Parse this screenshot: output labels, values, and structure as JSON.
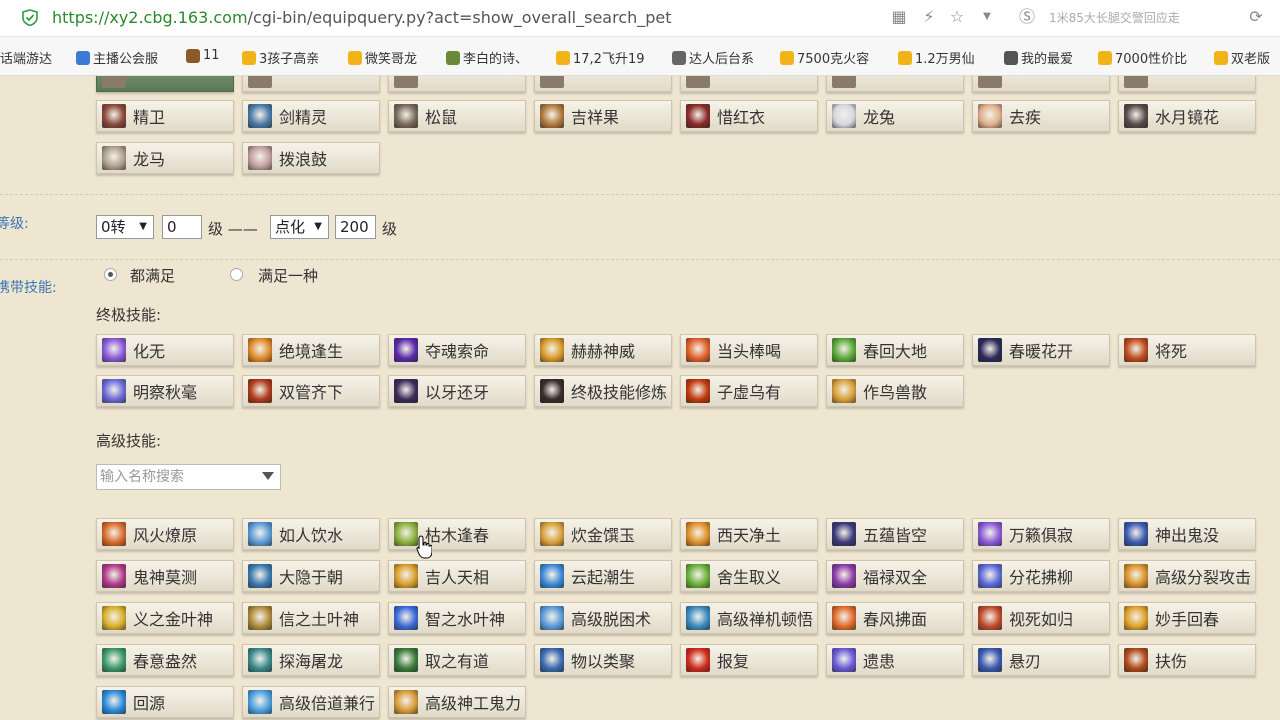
{
  "browser": {
    "url_host": "https://xy2.cbg.163.com",
    "url_path": "/cgi-bin/equipquery.py?act=show_overall_search_pet",
    "side_search": "1米85大长腿交警回应走",
    "bookmarks": [
      {
        "label": "话端游达",
        "color": "#d6a73a"
      },
      {
        "label": "主播公会服",
        "color": "#3a7bd6"
      },
      {
        "label": "11",
        "color": "#8a5a2a"
      },
      {
        "label": "3孩子高亲",
        "color": "#f0b418"
      },
      {
        "label": "微笑哥龙",
        "color": "#f0b418"
      },
      {
        "label": "李白的诗、",
        "color": "#6a8a3a"
      },
      {
        "label": "17,2飞升19",
        "color": "#f0b418"
      },
      {
        "label": "达人后台系",
        "color": "#666666"
      },
      {
        "label": "7500克火容",
        "color": "#f0b418"
      },
      {
        "label": "1.2万男仙",
        "color": "#f0b418"
      },
      {
        "label": "我的最爱",
        "color": "#555555"
      },
      {
        "label": "7000性价比",
        "color": "#f0b418"
      },
      {
        "label": "双老版",
        "color": "#f0b418"
      }
    ]
  },
  "pets_row_partial": [
    "",
    "",
    "",
    "",
    "",
    "",
    "",
    ""
  ],
  "pets": [
    {
      "label": "精卫",
      "color": "#8a4a3a"
    },
    {
      "label": "剑精灵",
      "color": "#4a7aa8"
    },
    {
      "label": "松鼠",
      "color": "#7a6a5a"
    },
    {
      "label": "吉祥果",
      "color": "#b07a3a"
    },
    {
      "label": "惜红衣",
      "color": "#8a2a2a"
    },
    {
      "label": "龙兔",
      "color": "#d8d8e0"
    },
    {
      "label": "去疾",
      "color": "#e0b08a"
    },
    {
      "label": "水月镜花",
      "color": "#5a4a4a"
    },
    {
      "label": "龙马",
      "color": "#b0a090"
    },
    {
      "label": "拨浪鼓",
      "color": "#c0a0a0"
    }
  ],
  "level": {
    "label": "等级:",
    "from_rebirth": "0转",
    "from_level": "0",
    "unit1": "级 ——",
    "to_rebirth": "点化",
    "to_level": "200",
    "unit2": "级"
  },
  "skills": {
    "label": "携带技能:",
    "option_all": "都满足",
    "option_one": "满足一种",
    "ultimate_label": "终极技能:",
    "advanced_label": "高级技能:",
    "search_placeholder": "输入名称搜索",
    "ultimate": [
      {
        "label": "化无",
        "color": "#8a5ad8"
      },
      {
        "label": "绝境逢生",
        "color": "#e08a2a"
      },
      {
        "label": "夺魂索命",
        "color": "#5a2aa8"
      },
      {
        "label": "赫赫神威",
        "color": "#d89a2a"
      },
      {
        "label": "当头棒喝",
        "color": "#e0602a"
      },
      {
        "label": "春回大地",
        "color": "#5aa83a"
      },
      {
        "label": "春暖花开",
        "color": "#2a2a5a"
      },
      {
        "label": "将死",
        "color": "#c04a1a"
      },
      {
        "label": "明察秋毫",
        "color": "#6a6ad8"
      },
      {
        "label": "双管齐下",
        "color": "#b03a1a"
      },
      {
        "label": "以牙还牙",
        "color": "#3a2a5a"
      },
      {
        "label": "终极技能修炼",
        "color": "#3a2a2a"
      },
      {
        "label": "子虚乌有",
        "color": "#c03a0a"
      },
      {
        "label": "作鸟兽散",
        "color": "#d8a03a"
      }
    ],
    "advanced": [
      {
        "label": "风火燎原",
        "color": "#d86a2a"
      },
      {
        "label": "如人饮水",
        "color": "#5a9ad8"
      },
      {
        "label": "枯木逢春",
        "color": "#8ab03a"
      },
      {
        "label": "炊金馔玉",
        "color": "#d8a03a"
      },
      {
        "label": "西天净土",
        "color": "#e0902a"
      },
      {
        "label": "五蕴皆空",
        "color": "#3a3a7a"
      },
      {
        "label": "万籁俱寂",
        "color": "#8a5ad8"
      },
      {
        "label": "神出鬼没",
        "color": "#3a5ab0"
      },
      {
        "label": "鬼神莫测",
        "color": "#b03a8a"
      },
      {
        "label": "大隐于朝",
        "color": "#3a7ab0"
      },
      {
        "label": "吉人天相",
        "color": "#d8a02a"
      },
      {
        "label": "云起潮生",
        "color": "#3a8ad8"
      },
      {
        "label": "舍生取义",
        "color": "#6ab03a"
      },
      {
        "label": "福禄双全",
        "color": "#8a3aa8"
      },
      {
        "label": "分花拂柳",
        "color": "#5a6ad8"
      },
      {
        "label": "高级分裂攻击",
        "color": "#d8902a"
      },
      {
        "label": "义之金叶神",
        "color": "#d8b02a"
      },
      {
        "label": "信之土叶神",
        "color": "#b08a3a"
      },
      {
        "label": "智之水叶神",
        "color": "#3a6ad8"
      },
      {
        "label": "高级脱困术",
        "color": "#5a9ad8"
      },
      {
        "label": "高级禅机顿悟",
        "color": "#3a8ac0"
      },
      {
        "label": "春风拂面",
        "color": "#e06a2a"
      },
      {
        "label": "视死如归",
        "color": "#c04a2a"
      },
      {
        "label": "妙手回春",
        "color": "#e0a02a"
      },
      {
        "label": "春意盎然",
        "color": "#3a9a6a"
      },
      {
        "label": "探海屠龙",
        "color": "#3a8a8a"
      },
      {
        "label": "取之有道",
        "color": "#3a7a3a"
      },
      {
        "label": "物以类聚",
        "color": "#3a6ab0"
      },
      {
        "label": "报复",
        "color": "#d02a1a"
      },
      {
        "label": "遗患",
        "color": "#6a5ad8"
      },
      {
        "label": "悬刃",
        "color": "#3a5ab0"
      },
      {
        "label": "扶伤",
        "color": "#b04a1a"
      },
      {
        "label": "回源",
        "color": "#2a8ad8"
      },
      {
        "label": "高级倍道兼行",
        "color": "#4aa0e0"
      },
      {
        "label": "高级神工鬼力",
        "color": "#d89a3a"
      }
    ]
  }
}
